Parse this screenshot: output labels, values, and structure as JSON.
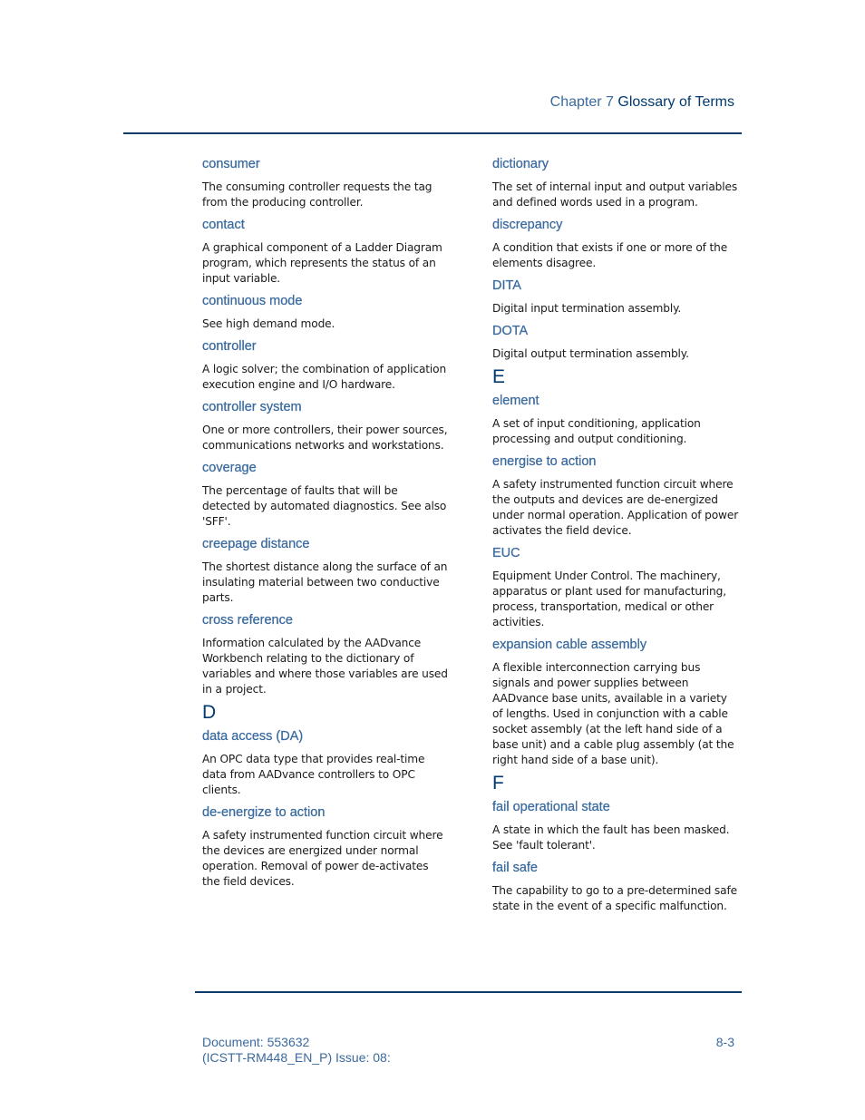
{
  "header": {
    "chapter_label": "Chapter 7",
    "section_title": "Glossary of Terms"
  },
  "colors": {
    "term": "#3a6a9e",
    "letter": "#003a70",
    "rule": "#0d3a6a",
    "body_text": "#1a1a1a"
  },
  "left_column": [
    {
      "type": "term",
      "term": "consumer",
      "definition": " The consuming controller requests the tag from the producing controller."
    },
    {
      "type": "term",
      "term": "contact",
      "definition": "A graphical component of a Ladder Diagram program, which represents the status of an input variable."
    },
    {
      "type": "term",
      "term": "continuous mode",
      "definition": "See high demand mode."
    },
    {
      "type": "term",
      "term": "controller",
      "definition": "A logic solver; the combination of application execution engine and I/O hardware."
    },
    {
      "type": "term",
      "term": "controller system",
      "definition": "One or more controllers, their power sources, communications networks and workstations."
    },
    {
      "type": "term",
      "term": "coverage",
      "definition": "The percentage of faults that will be detected by automated diagnostics. See also 'SFF'."
    },
    {
      "type": "term",
      "term": "creepage distance",
      "definition": "The shortest distance along the surface of an insulating material between two conductive parts."
    },
    {
      "type": "term",
      "term": "cross reference",
      "definition": "Information calculated by the AADvance Workbench relating to the dictionary of variables and where those variables are used in a project."
    },
    {
      "type": "letter",
      "letter": "D"
    },
    {
      "type": "term",
      "term": "data access (DA)",
      "definition": "An OPC data type that provides real-time data from AADvance controllers to OPC clients."
    },
    {
      "type": "term",
      "term": "de-energize to action",
      "definition": "A safety instrumented function circuit where the devices are energized under normal operation. Removal of power de-activates the field devices."
    }
  ],
  "right_column": [
    {
      "type": "term",
      "term": "dictionary",
      "definition": "The set of internal input and output variables and defined words used in a program."
    },
    {
      "type": "term",
      "term": "discrepancy",
      "definition": "A condition that exists if one or more of the elements disagree."
    },
    {
      "type": "term",
      "term": "DITA",
      "definition": "Digital input termination assembly."
    },
    {
      "type": "term",
      "term": "DOTA",
      "definition": "Digital output termination assembly."
    },
    {
      "type": "letter",
      "letter": "E"
    },
    {
      "type": "term",
      "term": "element",
      "definition": "A set of input conditioning, application processing and output conditioning."
    },
    {
      "type": "term",
      "term": "energise to action",
      "definition": "A safety instrumented function circuit where the outputs and devices are de-energized under normal operation. Application of power activates the field device."
    },
    {
      "type": "term",
      "term": "EUC",
      "definition": "Equipment Under Control. The machinery, apparatus or plant used for manufacturing, process, transportation, medical or other activities."
    },
    {
      "type": "term",
      "term": "expansion cable assembly",
      "definition": "A flexible interconnection carrying bus signals and power supplies between AADvance base units, available in a variety of lengths. Used in conjunction with a cable socket assembly (at the left hand side of a base unit) and a cable plug assembly (at the right hand side of a base unit)."
    },
    {
      "type": "letter",
      "letter": "F"
    },
    {
      "type": "term",
      "term": "fail operational state",
      "definition": "A state in which the fault has been masked. See 'fault tolerant'."
    },
    {
      "type": "term",
      "term": "fail safe",
      "definition": "The capability to go to a pre-determined safe state in the event of a specific malfunction."
    }
  ],
  "footer": {
    "document_line": "Document: 553632",
    "issue_line": "(ICSTT-RM448_EN_P) Issue: 08:",
    "page_number": "8-3"
  }
}
